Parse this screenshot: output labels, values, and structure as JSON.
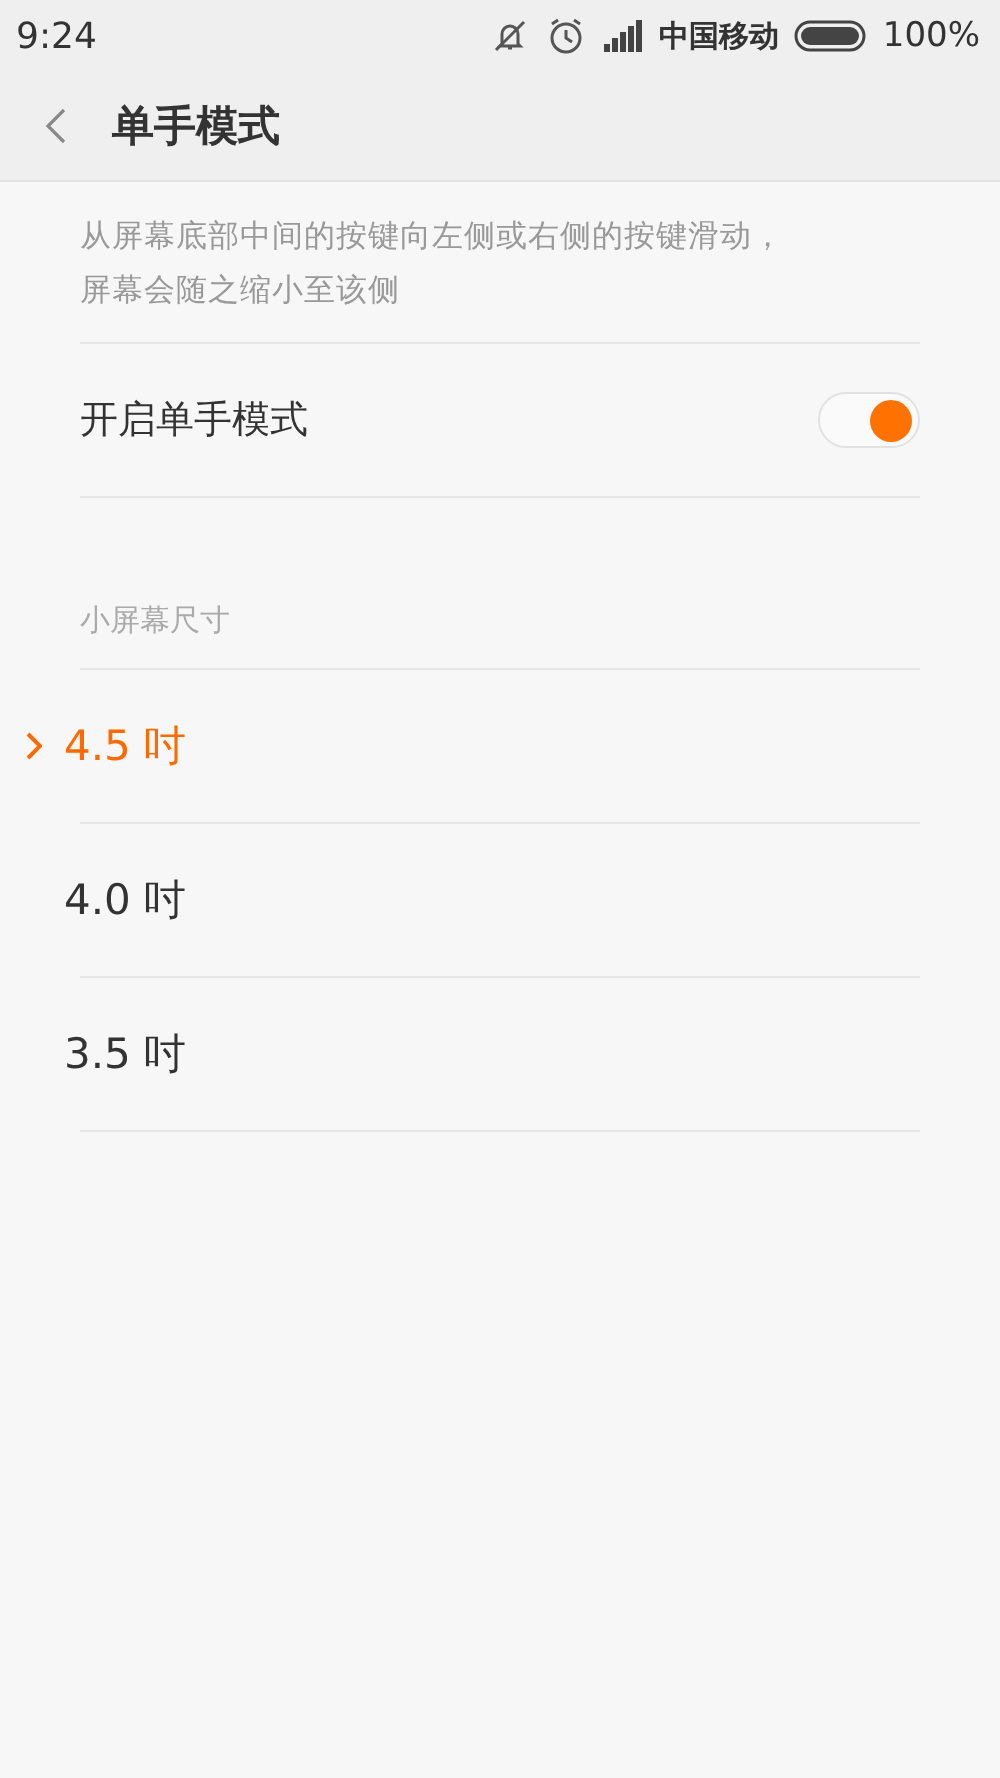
{
  "status_bar": {
    "time": "9:24",
    "carrier": "中国移动",
    "battery": "100%"
  },
  "header": {
    "title": "单手模式"
  },
  "description": "从屏幕底部中间的按键向左侧或右侧的按键滑动，屏幕会随之缩小至该侧",
  "toggle": {
    "label": "开启单手模式",
    "on": true
  },
  "section": {
    "title": "小屏幕尺寸"
  },
  "options": [
    {
      "label": "4.5 吋",
      "selected": true
    },
    {
      "label": "4.0 吋",
      "selected": false
    },
    {
      "label": "3.5 吋",
      "selected": false
    }
  ]
}
